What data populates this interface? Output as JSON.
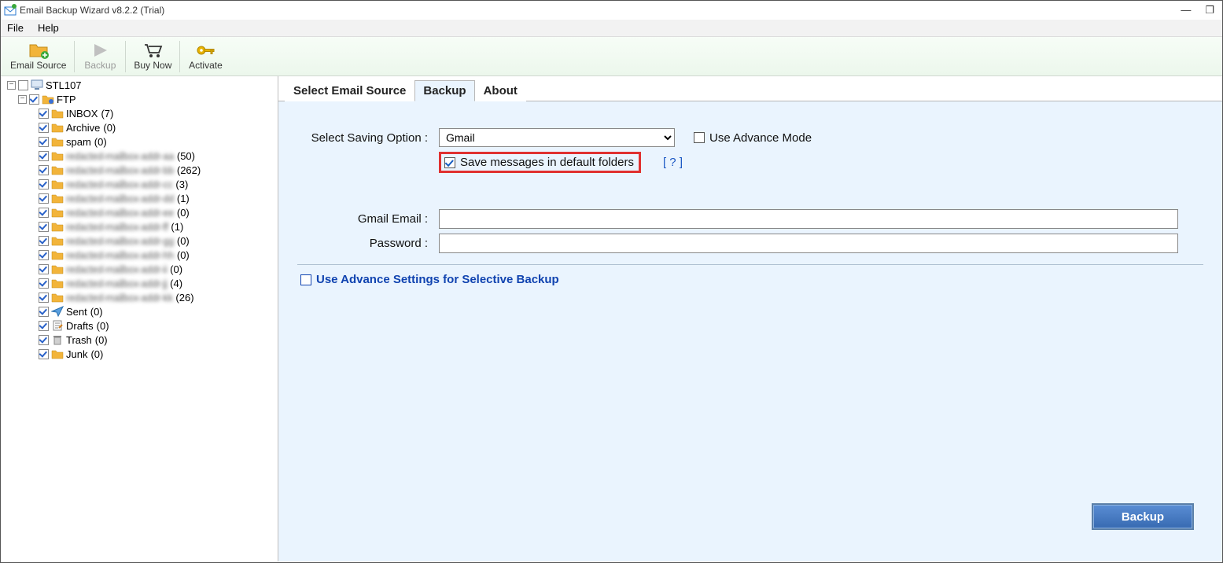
{
  "window": {
    "title": "Email Backup Wizard v8.2.2 (Trial)"
  },
  "menu": {
    "file": "File",
    "help": "Help"
  },
  "toolbar": {
    "email_source": "Email Source",
    "backup": "Backup",
    "buy_now": "Buy Now",
    "activate": "Activate"
  },
  "tree": {
    "root": "STL107",
    "ftp": "FTP",
    "items": [
      {
        "label": "INBOX",
        "count": "(7)",
        "blur": false
      },
      {
        "label": "Archive",
        "count": "(0)",
        "blur": false
      },
      {
        "label": "spam",
        "count": "(0)",
        "blur": false
      },
      {
        "label": "redacted-mailbox-addr-aa",
        "count": "(50)",
        "blur": true
      },
      {
        "label": "redacted-mailbox-addr-bb",
        "count": "(262)",
        "blur": true
      },
      {
        "label": "redacted-mailbox-addr-cc",
        "count": "(3)",
        "blur": true
      },
      {
        "label": "redacted-mailbox-addr-dd",
        "count": "(1)",
        "blur": true
      },
      {
        "label": "redacted-mailbox-addr-ee",
        "count": "(0)",
        "blur": true
      },
      {
        "label": "redacted-mailbox-addr-ff",
        "count": "(1)",
        "blur": true
      },
      {
        "label": "redacted-mailbox-addr-gg",
        "count": "(0)",
        "blur": true
      },
      {
        "label": "redacted-mailbox-addr-hh",
        "count": "(0)",
        "blur": true
      },
      {
        "label": "redacted-mailbox-addr-ii",
        "count": "(0)",
        "blur": true
      },
      {
        "label": "redacted-mailbox-addr-jj",
        "count": "(4)",
        "blur": true
      },
      {
        "label": "redacted-mailbox-addr-kk",
        "count": "(26)",
        "blur": true
      },
      {
        "label": "Sent",
        "count": "(0)",
        "blur": false
      },
      {
        "label": "Drafts",
        "count": "(0)",
        "blur": false
      },
      {
        "label": "Trash",
        "count": "(0)",
        "blur": false
      },
      {
        "label": "Junk",
        "count": "(0)",
        "blur": false
      }
    ]
  },
  "tabs": {
    "t1": "Select Email Source",
    "t2": "Backup",
    "t3": "About"
  },
  "form": {
    "saving_label": "Select Saving Option  :",
    "saving_value": "Gmail",
    "adv_mode": "Use Advance Mode",
    "save_default": "Save messages in default folders",
    "help": "[ ? ]",
    "email_label": "Gmail Email  :",
    "pwd_label": "Password  :",
    "selective": "Use Advance Settings for Selective Backup",
    "backup_btn": "Backup"
  }
}
